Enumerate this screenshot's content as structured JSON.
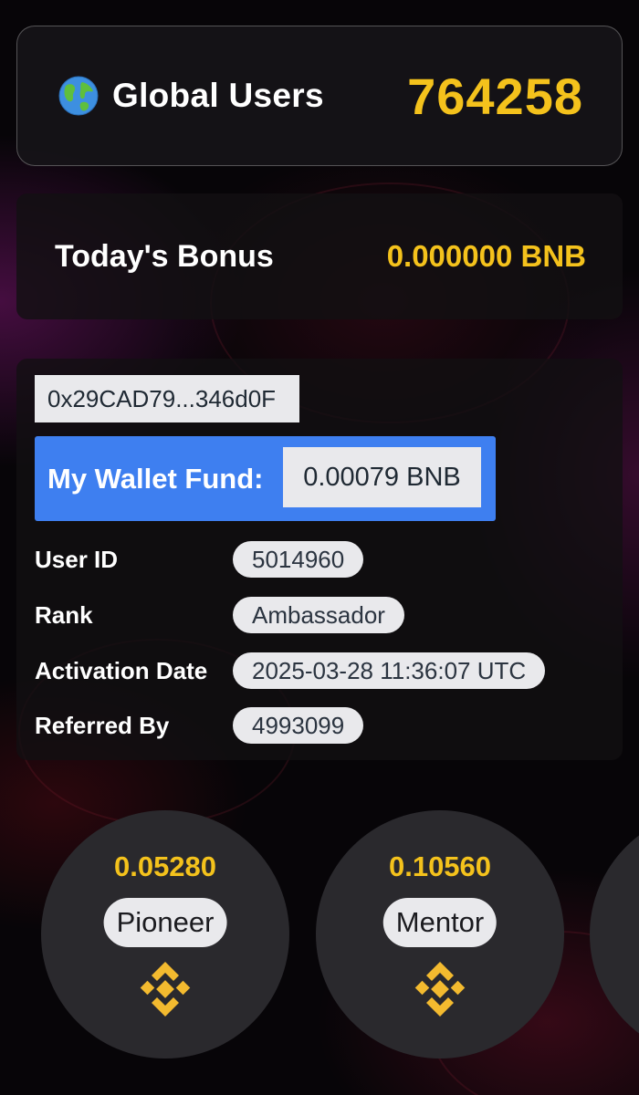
{
  "global_users": {
    "icon": "globe-icon",
    "label": "Global Users",
    "count": "764258"
  },
  "bonus": {
    "label": "Today's Bonus",
    "value": "0.000000 BNB"
  },
  "account": {
    "address": "0x29CAD79...346d0F",
    "wallet_label": "My Wallet Fund:",
    "wallet_value": "0.00079 BNB",
    "rows": [
      {
        "label": "User ID",
        "value": "5014960"
      },
      {
        "label": "Rank",
        "value": "Ambassador"
      },
      {
        "label": "Activation Date",
        "value": "2025-03-28 11:36:07 UTC"
      },
      {
        "label": "Referred By",
        "value": "4993099"
      }
    ]
  },
  "levels": [
    {
      "amount": "0.05280",
      "name": "Pioneer",
      "icon": "bnb-icon"
    },
    {
      "amount": "0.10560",
      "name": "Mentor",
      "icon": "bnb-icon"
    }
  ],
  "colors": {
    "accent_gold": "#f4c21c",
    "wallet_blue": "#3e7ff0",
    "pill_bg": "#e9e9ec",
    "circle_bg": "#2a292d"
  }
}
